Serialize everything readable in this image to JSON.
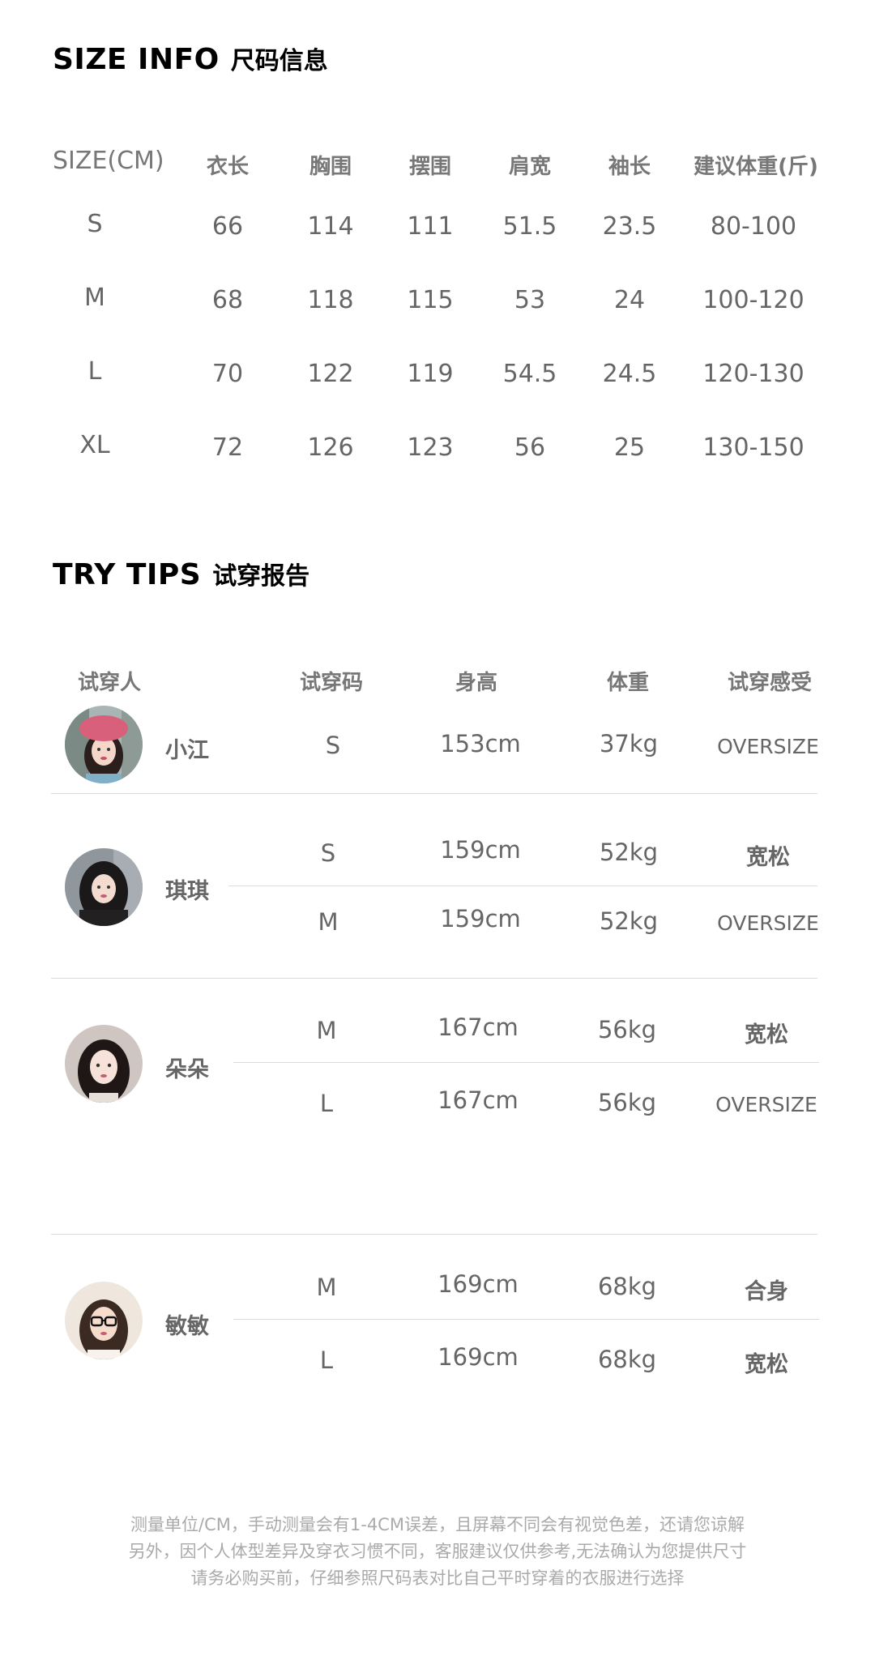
{
  "size_info": {
    "title_en": "SIZE INFO",
    "title_zh": "尺码信息",
    "headers": [
      "SIZE(CM)",
      "衣长",
      "胸围",
      "摆围",
      "肩宽",
      "袖长",
      "建议体重(斤)"
    ],
    "rows": [
      [
        "S",
        "66",
        "114",
        "111",
        "51.5",
        "23.5",
        "80-100"
      ],
      [
        "M",
        "68",
        "118",
        "115",
        "53",
        "24",
        "100-120"
      ],
      [
        "L",
        "70",
        "122",
        "119",
        "54.5",
        "24.5",
        "120-130"
      ],
      [
        "XL",
        "72",
        "126",
        "123",
        "56",
        "25",
        "130-150"
      ]
    ]
  },
  "try_tips": {
    "title_en": "TRY TIPS",
    "title_zh": "试穿报告",
    "headers": [
      "试穿人",
      "试穿码",
      "身高",
      "体重",
      "试穿感受"
    ],
    "people": [
      {
        "name": "小江",
        "avatar_icon": "avatar-pink-beret",
        "rows": [
          {
            "size": "S",
            "height": "153cm",
            "weight": "37kg",
            "feel": "OVERSIZE"
          }
        ]
      },
      {
        "name": "琪琪",
        "avatar_icon": "avatar-black-hood",
        "rows": [
          {
            "size": "S",
            "height": "159cm",
            "weight": "52kg",
            "feel": "宽松"
          },
          {
            "size": "M",
            "height": "159cm",
            "weight": "52kg",
            "feel": "OVERSIZE"
          }
        ]
      },
      {
        "name": "朵朵",
        "avatar_icon": "avatar-dark-hair",
        "rows": [
          {
            "size": "M",
            "height": "167cm",
            "weight": "56kg",
            "feel": "宽松"
          },
          {
            "size": "L",
            "height": "167cm",
            "weight": "56kg",
            "feel": "OVERSIZE"
          }
        ]
      },
      {
        "name": "敏敏",
        "avatar_icon": "avatar-glasses",
        "rows": [
          {
            "size": "M",
            "height": "169cm",
            "weight": "68kg",
            "feel": "合身"
          },
          {
            "size": "L",
            "height": "169cm",
            "weight": "68kg",
            "feel": "宽松"
          }
        ]
      }
    ]
  },
  "footer": {
    "line1": "测量单位/CM，手动测量会有1-4CM误差，且屏幕不同会有视觉色差，还请您谅解",
    "line2": "另外，因个人体型差异及穿衣习惯不同，客服建议仅供参考,无法确认为您提供尺寸",
    "line3": "请务必购买前，仔细参照尺码表对比自己平时穿着的衣服进行选择"
  },
  "colors": {
    "title": "#000000",
    "text": "#666666",
    "header": "#777777",
    "divider": "#dcdcdc",
    "footer": "#aaaaaa"
  }
}
